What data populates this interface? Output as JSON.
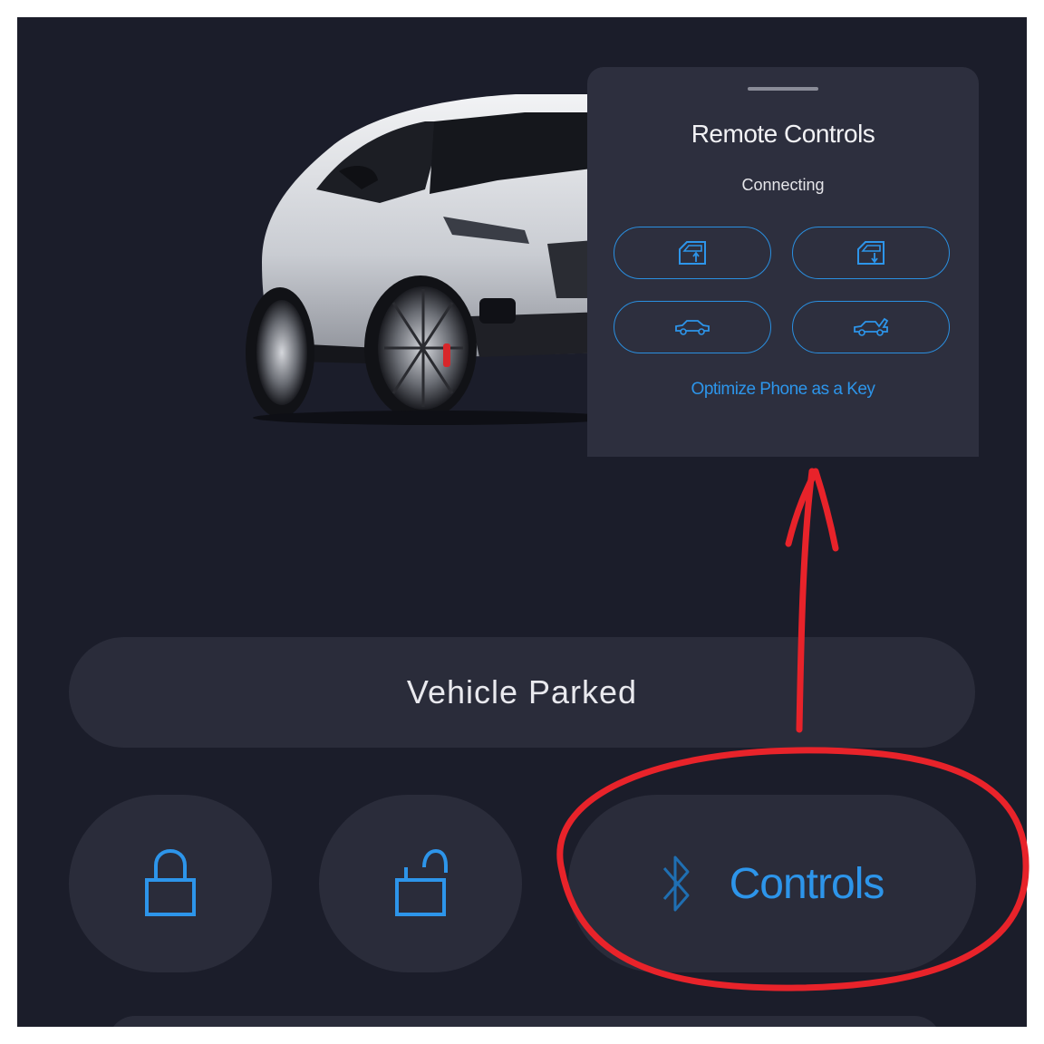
{
  "popup": {
    "title": "Remote Controls",
    "status": "Connecting",
    "buttons": [
      {
        "icon": "window-up-icon"
      },
      {
        "icon": "window-down-icon"
      },
      {
        "icon": "trunk-close-icon"
      },
      {
        "icon": "trunk-open-icon"
      }
    ],
    "link": "Optimize Phone as a Key"
  },
  "vehicle": {
    "status": "Vehicle Parked",
    "image": "white-suv"
  },
  "actions": {
    "lock_icon": "lock-icon",
    "unlock_icon": "unlock-icon",
    "bluetooth_icon": "bluetooth-icon",
    "controls_label": "Controls"
  },
  "colors": {
    "background": "#1b1d2a",
    "card": "#2a2c3a",
    "popup": "#2d2f3e",
    "accent": "#2d95ea",
    "annotation": "#e8232a"
  }
}
